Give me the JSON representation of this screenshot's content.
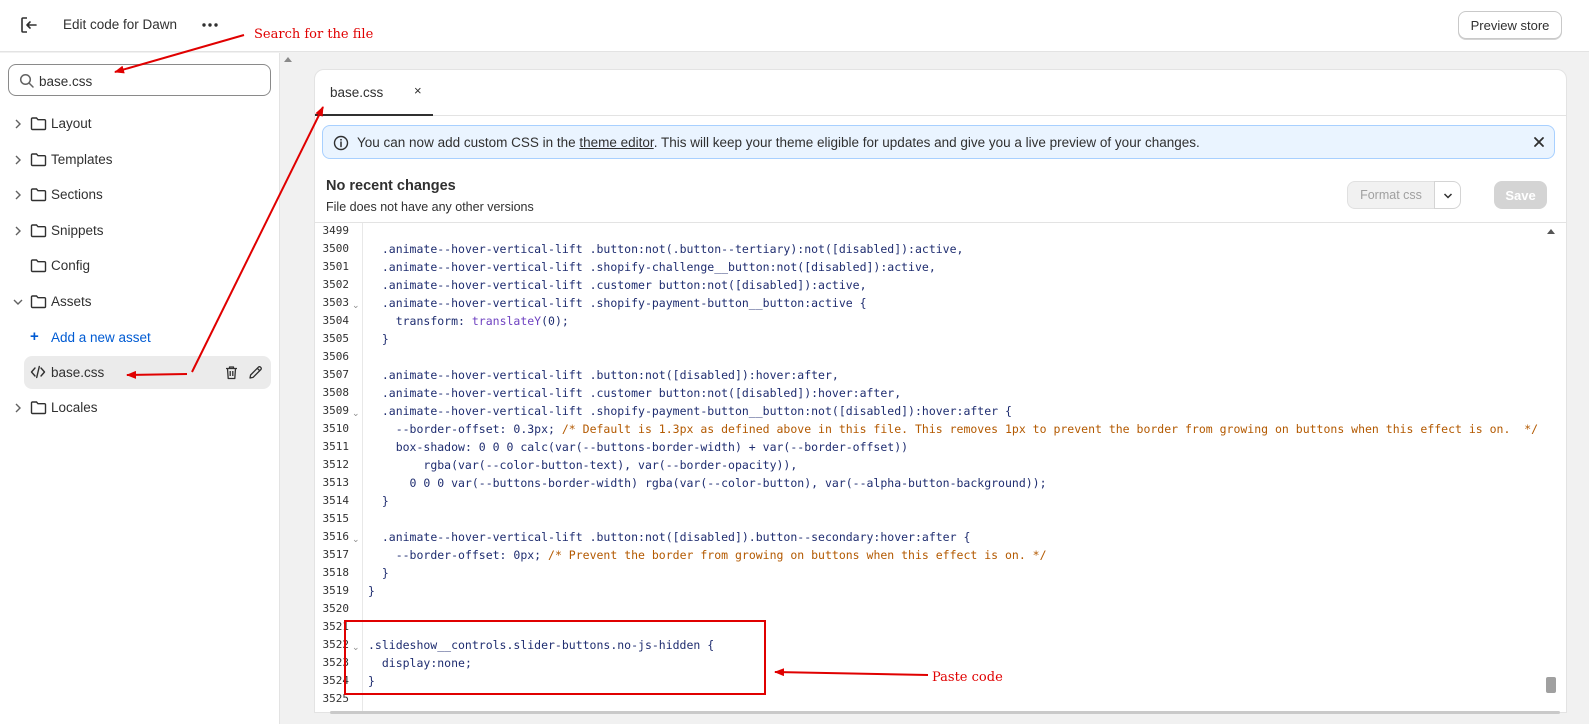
{
  "topbar": {
    "title": "Edit code for Dawn",
    "preview_label": "Preview store",
    "exit_icon": "exit-icon",
    "more_icon": "more-horizontal-icon"
  },
  "sidebar": {
    "search": {
      "value": "base.css",
      "placeholder": ""
    },
    "folders": {
      "layout": "Layout",
      "templates": "Templates",
      "sections": "Sections",
      "snippets": "Snippets",
      "config": "Config",
      "assets": "Assets",
      "locales": "Locales"
    },
    "add_asset_label": "Add a new asset",
    "asset_file": "base.css"
  },
  "editor": {
    "tab_name": "base.css",
    "tab_close": "×",
    "banner": {
      "prefix": "You can now add custom CSS in the ",
      "link": "theme editor",
      "suffix": ". This will keep your theme eligible for updates and give you a live preview of your changes."
    },
    "changes_title": "No recent changes",
    "changes_subtitle": "File does not have any other versions",
    "format_label": "Format css",
    "save_label": "Save",
    "accent_color": "#005bd3",
    "annotation_color": "#e00000"
  },
  "code": {
    "line_numbers": [
      "3499",
      "3500",
      "3501",
      "3502",
      "3503",
      "3504",
      "3505",
      "3506",
      "3507",
      "3508",
      "3509",
      "3510",
      "3511",
      "3512",
      "3513",
      "3514",
      "3515",
      "3516",
      "3517",
      "3518",
      "3519",
      "3520",
      "3521",
      "3522",
      "3523",
      "3524",
      "3525"
    ],
    "l3500": ".animate--hover-vertical-lift .button:not(.button--tertiary):not([disabled]):active,",
    "l3501": ".animate--hover-vertical-lift .shopify-challenge__button:not([disabled]):active,",
    "l3502": ".animate--hover-vertical-lift .customer button:not([disabled]):active,",
    "l3503": ".animate--hover-vertical-lift .shopify-payment-button__button:active {",
    "l3504_prop": "transform: ",
    "l3504_fn": "translateY",
    "l3504_rest": "(0);",
    "l3505": "}",
    "l3507": ".animate--hover-vertical-lift .button:not([disabled]):hover:after,",
    "l3508": ".animate--hover-vertical-lift .customer button:not([disabled]):hover:after,",
    "l3509": ".animate--hover-vertical-lift .shopify-payment-button__button:not([disabled]):hover:after {",
    "l3510_prop": "--border-offset: 0.3px; ",
    "l3510_cmt": "/* Default is 1.3px as defined above in this file. This removes 1px to prevent the border from growing on buttons when this effect is on.  */",
    "l3511": "box-shadow: 0 0 0 calc(var(--buttons-border-width) + var(--border-offset))",
    "l3512": "rgba(var(--color-button-text), var(--border-opacity)),",
    "l3513": "0 0 0 var(--buttons-border-width) rgba(var(--color-button), var(--alpha-button-background));",
    "l3514": "}",
    "l3516": ".animate--hover-vertical-lift .button:not([disabled]).button--secondary:hover:after {",
    "l3517_prop": "--border-offset: 0px; ",
    "l3517_cmt": "/* Prevent the border from growing on buttons when this effect is on. */",
    "l3518": "}",
    "l3519": "}",
    "l3522": ".slideshow__controls.slider-buttons.no-js-hidden {",
    "l3523": "display:none;",
    "l3524": "}"
  },
  "annotations": {
    "search": "Search for the file",
    "paste": "Paste code"
  }
}
